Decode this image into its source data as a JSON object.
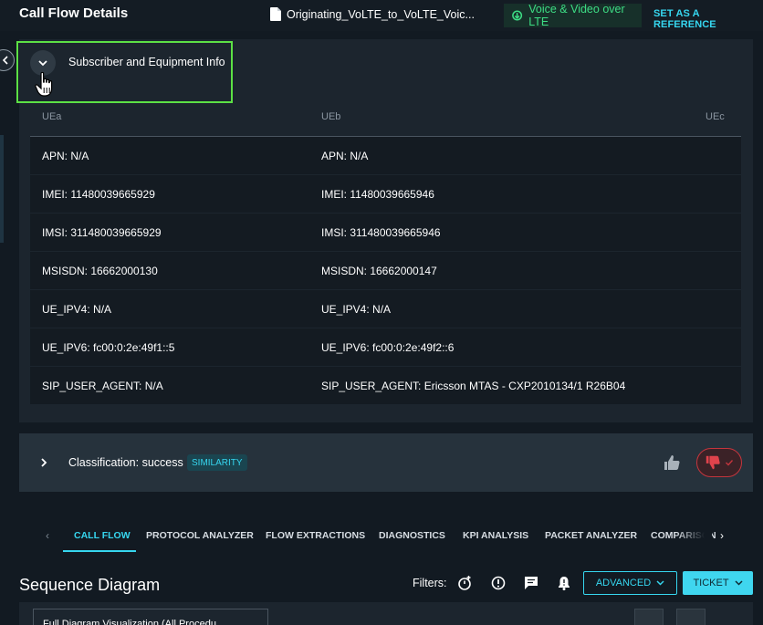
{
  "header": {
    "title": "Call Flow Details",
    "file_name": "Originating_VoLTE_to_VoLTE_Voic...",
    "service": "Voice & Video over LTE",
    "reference_link": "SET AS A REFERENCE"
  },
  "subscriber_section": {
    "title": "Subscriber and Equipment Info",
    "columns": [
      "UEa",
      "UEb",
      "UEc"
    ],
    "rows": [
      [
        "APN: N/A",
        "APN: N/A",
        ""
      ],
      [
        "IMEI: 11480039665929",
        "IMEI: 11480039665946",
        ""
      ],
      [
        "IMSI: 311480039665929",
        "IMSI: 311480039665946",
        ""
      ],
      [
        "MSISDN: 16662000130",
        "MSISDN: 16662000147",
        ""
      ],
      [
        "UE_IPV4: N/A",
        "UE_IPV4: N/A",
        ""
      ],
      [
        "UE_IPV6: fc00:0:2e:49f1::5",
        "UE_IPV6: fc00:0:2e:49f2::6",
        ""
      ],
      [
        "SIP_USER_AGENT: N/A",
        "SIP_USER_AGENT: Ericsson MTAS - CXP2010134/1 R26B04",
        ""
      ]
    ]
  },
  "classification": {
    "label": "Classification: success",
    "badge": "SIMILARITY"
  },
  "tabs": [
    {
      "label": "CALL FLOW",
      "active": true
    },
    {
      "label": "PROTOCOL ANALYZER",
      "active": false
    },
    {
      "label": "FLOW EXTRACTIONS",
      "active": false
    },
    {
      "label": "DIAGNOSTICS",
      "active": false
    },
    {
      "label": "KPI ANALYSIS",
      "active": false
    },
    {
      "label": "PACKET ANALYZER",
      "active": false
    },
    {
      "label": "COMPARISON",
      "active": false
    }
  ],
  "sequence": {
    "title": "Sequence Diagram",
    "filters_label": "Filters:",
    "advanced_label": "ADVANCED",
    "ticket_label": "TICKET",
    "visualization_select": "Full Diagram Visualization (All Procedu..."
  },
  "colors": {
    "accent": "#36d6ef",
    "success": "#3ddc84",
    "highlight_border": "#5ce045",
    "dislike": "#c4353d"
  }
}
